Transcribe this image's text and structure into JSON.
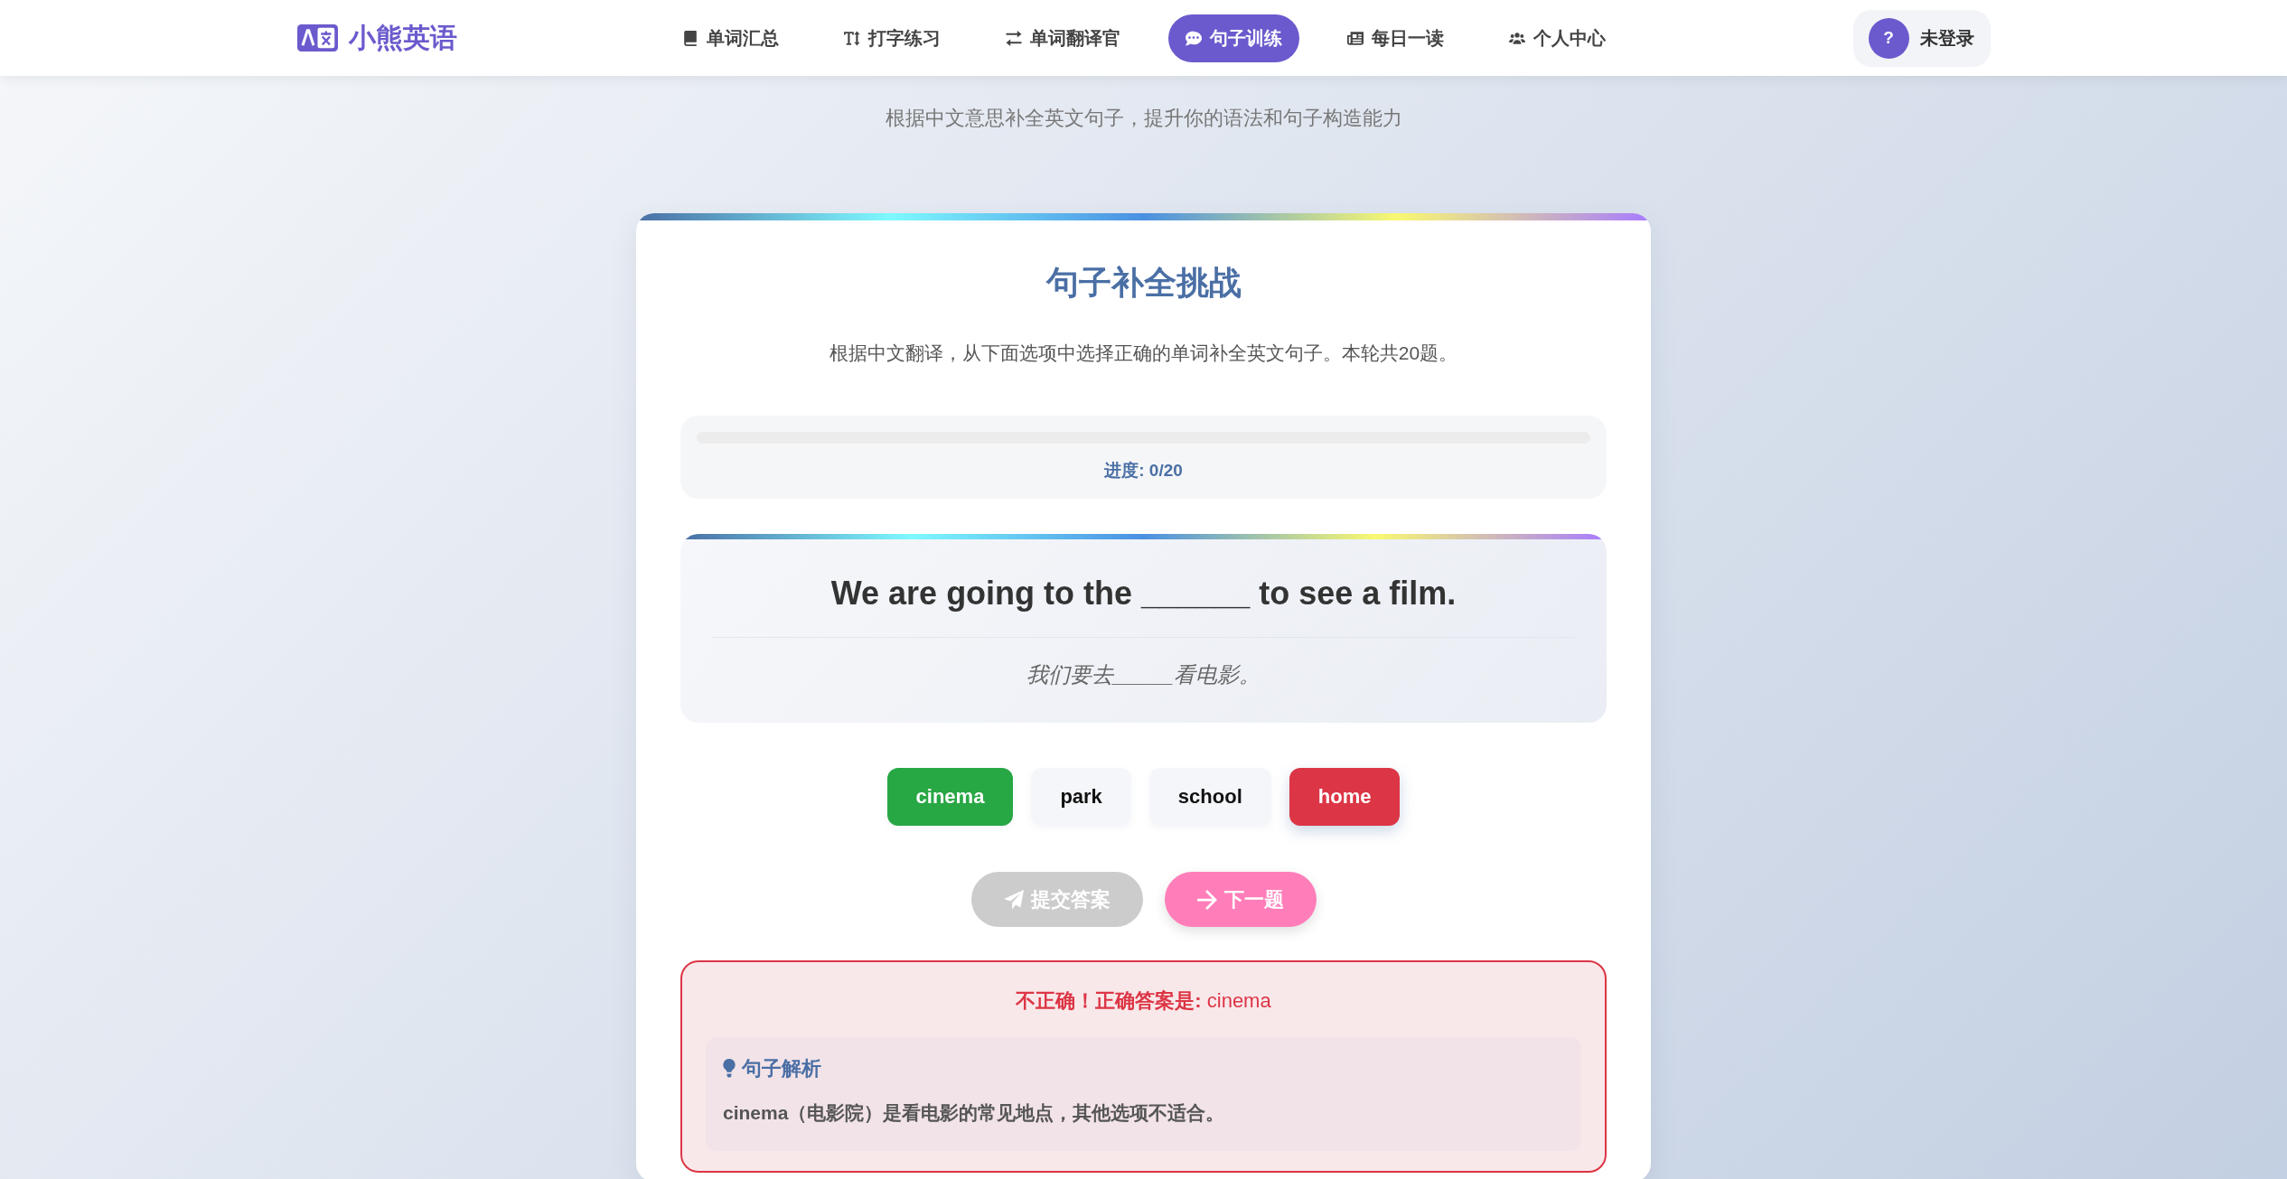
{
  "navbar": {
    "logo": "小熊英语",
    "items": [
      {
        "label": "单词汇总",
        "selected": false
      },
      {
        "label": "打字练习",
        "selected": false
      },
      {
        "label": "单词翻译官",
        "selected": false
      },
      {
        "label": "句子训练",
        "selected": true
      },
      {
        "label": "每日一读",
        "selected": false
      },
      {
        "label": "个人中心",
        "selected": false
      }
    ],
    "user": {
      "avatar": "?",
      "label": "未登录"
    }
  },
  "subtitle": "根据中文意思补全英文句子，提升你的语法和句子构造能力",
  "card": {
    "title": "句子补全挑战",
    "description": "根据中文翻译，从下面选项中选择正确的单词补全英文句子。本轮共20题。",
    "progress": {
      "level": 0,
      "label": "进度: 0/20"
    },
    "question": {
      "sentence": "We are going to the ______ to see a film.",
      "translation": "我们要去_____看电影。"
    },
    "options": [
      {
        "label": "cinema",
        "selected": false,
        "correct": true
      },
      {
        "label": "park",
        "selected": false,
        "correct": false
      },
      {
        "label": "school",
        "selected": false,
        "correct": false
      },
      {
        "label": "home",
        "selected": true,
        "correct": false
      }
    ],
    "buttons": [
      {
        "kind": "submit",
        "label": "提交答案",
        "disabled": true
      },
      {
        "kind": "next",
        "label": "下一题",
        "disabled": false
      }
    ],
    "feedback": {
      "kind": "incorrect",
      "message": "**不正确！正确答案是:** cinema",
      "explanation": {
        "title": "句子解析",
        "text": "cinema（电影院）是看电影的常见地点，其他选项不适合。"
      }
    }
  }
}
